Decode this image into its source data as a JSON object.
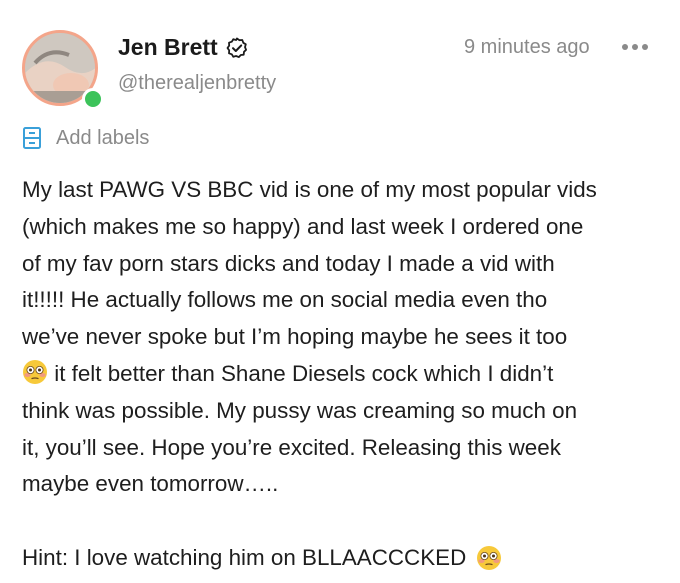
{
  "author": {
    "display_name": "Jen Brett",
    "handle": "@therealjenbretty",
    "verified": true,
    "online": true
  },
  "post": {
    "timestamp": "9 minutes ago",
    "add_labels": "Add labels",
    "body_line_1": "My last PAWG VS BBC vid is one of my most popular vids",
    "body_line_2": "(which makes me so happy) and last week I ordered one",
    "body_line_3": "of my fav porn stars dicks and today I made a vid with",
    "body_line_4": "it!!!!! He actually follows me on social media even tho",
    "body_line_5": "we’ve never spoke but I’m hoping maybe he sees it too",
    "body_line_6_after_emoji": " it felt better than Shane Diesels cock which I didn’t",
    "body_line_7": "think was possible. My pussy was creaming so much on",
    "body_line_8": "it, you’ll see. Hope you’re excited. Releasing this week",
    "body_line_9": "maybe even tomorrow…..",
    "hint": "Hint: I love watching him on BLLAACCCKED",
    "emoji": "flushed-face-icon"
  },
  "colors": {
    "avatar_ring": "#f4a58a",
    "online": "#3cc35a",
    "muted_text": "#8a8a8a",
    "label_icon": "#3aa0d9"
  },
  "icons": {
    "verified": "verified-badge-icon",
    "more": "more-options-icon",
    "label": "label-icon"
  }
}
